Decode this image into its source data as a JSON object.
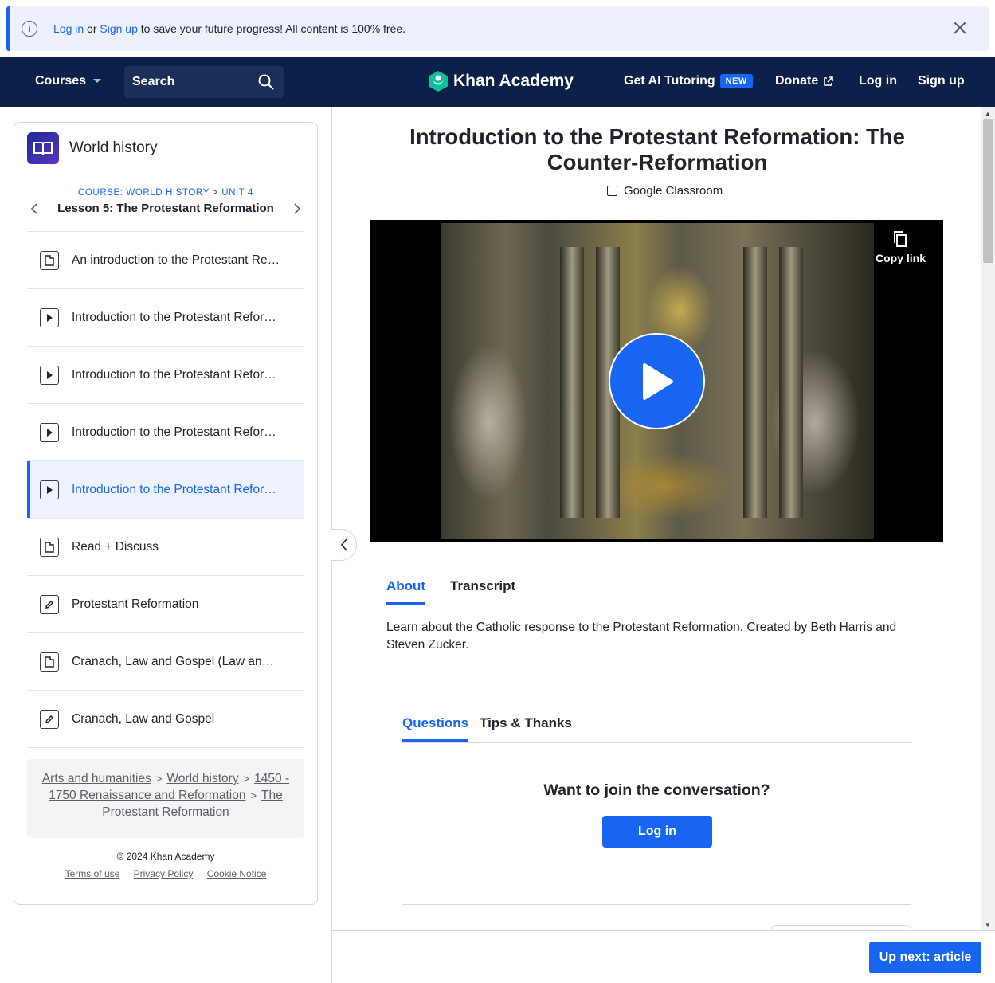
{
  "banner": {
    "login_link": "Log in",
    "or_text": " or ",
    "signup_link": "Sign up",
    "rest_text": " to save your future progress! All content is 100% free."
  },
  "nav": {
    "courses": "Courses",
    "search": "Search",
    "brand": "Khan Academy",
    "ai_tutoring": "Get AI Tutoring",
    "new_badge": "NEW",
    "donate": "Donate",
    "login": "Log in",
    "signup": "Sign up"
  },
  "sidebar": {
    "course_title": "World history",
    "crumb_course": "COURSE: WORLD HISTORY",
    "crumb_sep": ">",
    "crumb_unit": "UNIT 4",
    "lesson": "Lesson 5: The Protestant Reformation",
    "items": [
      {
        "label": "An introduction to the Protestant Reformation",
        "type": "article"
      },
      {
        "label": "Introduction to the Protestant Reformation: Setting the stage",
        "type": "video"
      },
      {
        "label": "Introduction to the Protestant Reformation: Martin Luther",
        "type": "video"
      },
      {
        "label": "Introduction to the Protestant Reformation: Varieties of Protestantism",
        "type": "video"
      },
      {
        "label": "Introduction to the Protestant Reformation: The Counter-Reformation",
        "type": "video",
        "active": true
      },
      {
        "label": "Read + Discuss",
        "type": "article"
      },
      {
        "label": "Protestant Reformation",
        "type": "exercise"
      },
      {
        "label": "Cranach, Law and Gospel (Law and Grace)",
        "type": "article"
      },
      {
        "label": "Cranach, Law and Gospel",
        "type": "exercise"
      }
    ],
    "breadcrumbs": {
      "arts": "Arts and humanities",
      "world": "World history",
      "period": "1450 - 1750 Renaissance and Reformation",
      "topic": "The Protestant Reformation",
      "sep": ">"
    },
    "footer": {
      "copyright": "© 2024 Khan Academy",
      "terms": "Terms of use",
      "privacy": "Privacy Policy",
      "cookie": "Cookie Notice"
    }
  },
  "main": {
    "title": "Introduction to the Protestant Reformation: The Counter-Reformation",
    "google_classroom": "Google Classroom",
    "video": {
      "copy_link": "Copy link"
    },
    "tabs": [
      "About",
      "Transcript"
    ],
    "about": "Learn about the Catholic response to the Protestant Reformation.  Created by Beth Harris and Steven Zucker.",
    "discussion_tabs": [
      "Questions",
      "Tips & Thanks"
    ],
    "join_prompt": "Want to join the conversation?",
    "login_button": "Log in",
    "up_next": "Up next: article"
  },
  "colors": {
    "accent": "#1865f2",
    "nav_bg": "#0b2149",
    "banner_bg": "#edf1fb"
  }
}
